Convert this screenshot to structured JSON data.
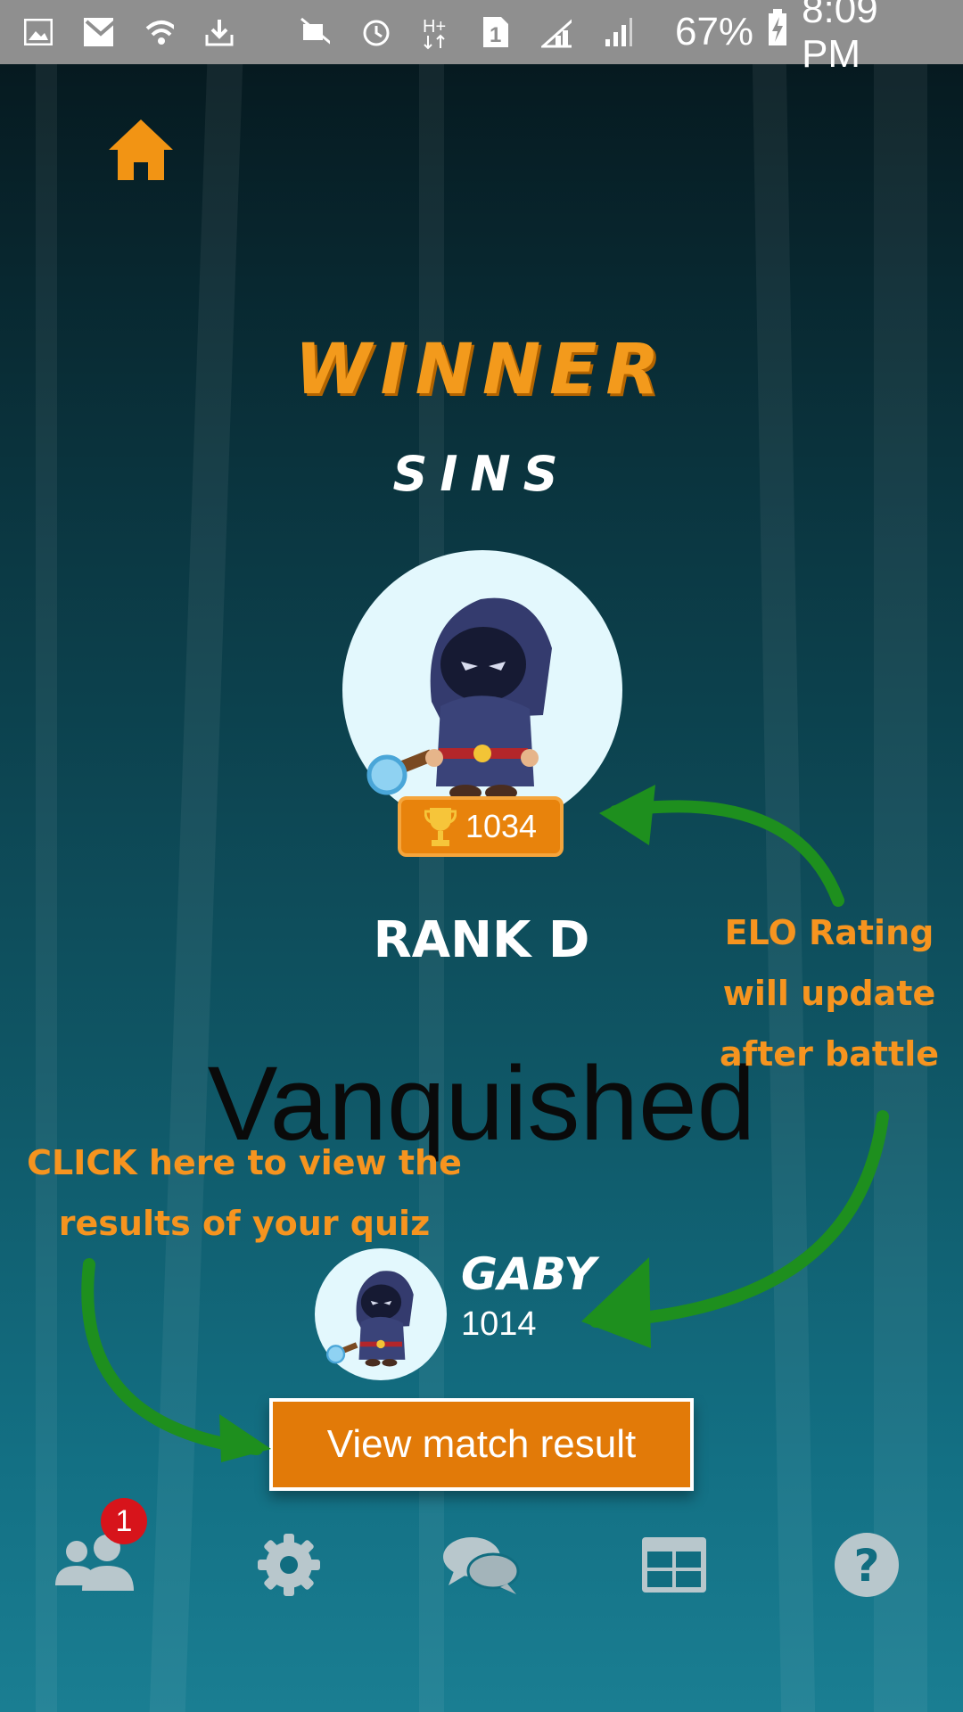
{
  "status_bar": {
    "battery": "67%",
    "time": "8:09 PM",
    "icons": [
      "gallery-icon",
      "gmail-icon",
      "wifi-icon",
      "download-icon",
      "mute-icon",
      "alarm-icon",
      "hplus-icon",
      "sim1-icon",
      "signal-icon",
      "signal2-icon",
      "battery-charging-icon"
    ]
  },
  "header": {
    "home_icon": "home-icon"
  },
  "result": {
    "heading": "WINNER",
    "player_name": "SINS",
    "player_elo": "1034",
    "rank": "RANK D",
    "outcome": "Vanquished"
  },
  "opponent": {
    "name": "GABY",
    "elo": "1014"
  },
  "annotations": {
    "elo_note": [
      "ELO Rating",
      "will update",
      "after battle"
    ],
    "click_note": [
      "CLICK here to view the",
      "results of your quiz"
    ]
  },
  "actions": {
    "view_result_label": "View match result"
  },
  "bottom_nav": {
    "items": [
      {
        "icon": "friends-icon",
        "badge": "1"
      },
      {
        "icon": "settings-icon"
      },
      {
        "icon": "chat-icon"
      },
      {
        "icon": "leaderboard-icon"
      },
      {
        "icon": "help-icon"
      }
    ]
  },
  "colors": {
    "accent": "#e27a08",
    "annotation": "#f6941f",
    "arrow": "#1e8f1e",
    "badge": "#d7141b"
  }
}
